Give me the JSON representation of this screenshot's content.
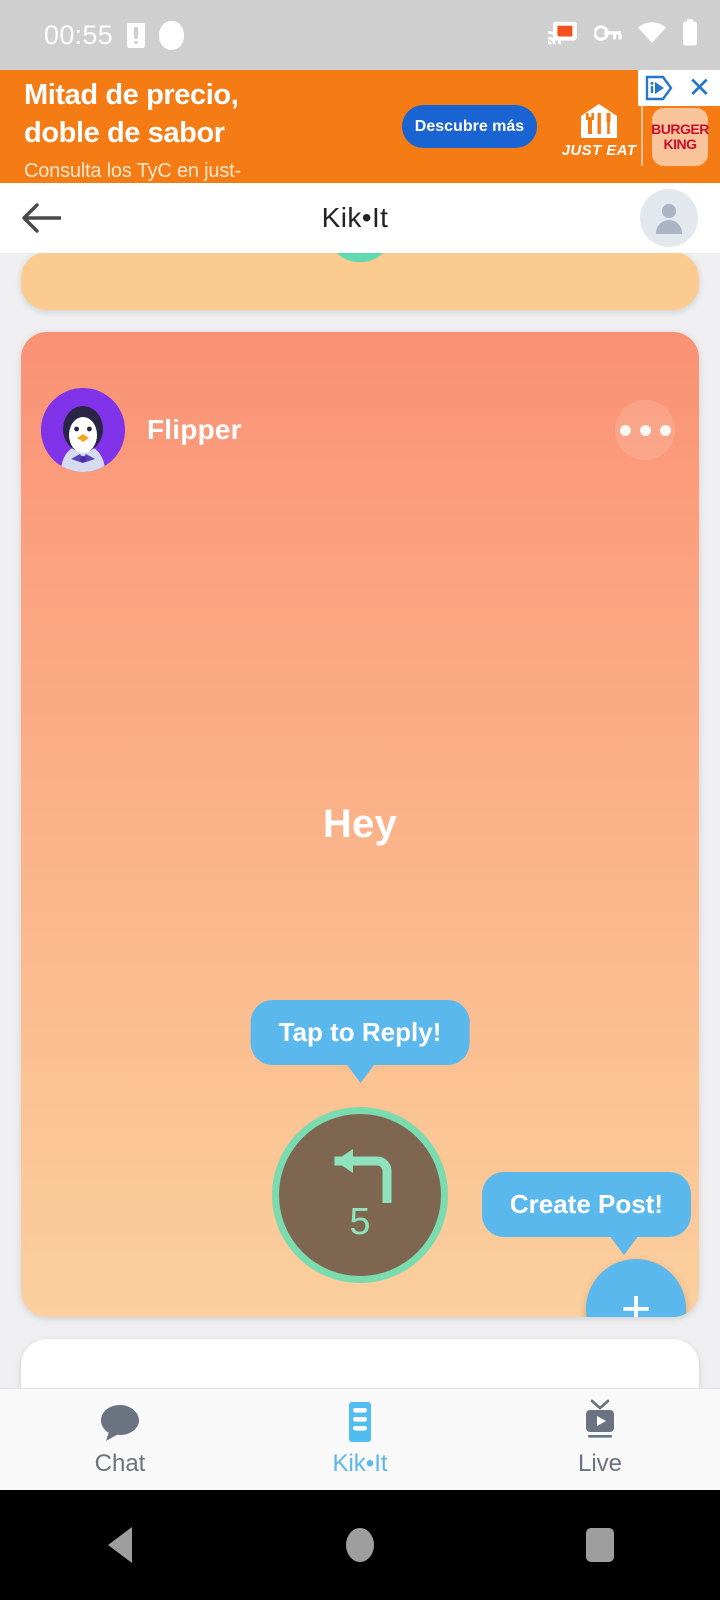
{
  "status_bar": {
    "time": "00:55",
    "icons": [
      "sim-card-icon",
      "recording-dot-icon",
      "cast-icon",
      "vpn-key-icon",
      "wifi-icon",
      "battery-icon"
    ]
  },
  "ad": {
    "headline_line1": "Mitad de precio,",
    "headline_line2": "doble de sabor",
    "subtext": "Consulta los TyC en just-eat.es/campana/descuentos",
    "cta_label": "Descubre más",
    "brand_name": "JUST EAT",
    "partner_line1": "BURGER",
    "partner_line2": "KING",
    "adchoices_icon": "adchoices-icon",
    "close_icon": "close-icon",
    "background_color": "#F57B14",
    "cta_color": "#1964D2"
  },
  "appbar": {
    "back_icon": "back-arrow-icon",
    "title": "Kik•It",
    "profile_icon": "account-avatar-icon"
  },
  "feed": {
    "previous_card": {
      "name": "previous-post-card"
    },
    "post": {
      "author": "Flipper",
      "avatar_icon": "penguin-avatar-icon",
      "more_icon": "more-options-icon",
      "message": "Hey",
      "reply_tooltip": "Tap to Reply!",
      "create_tooltip": "Create Post!",
      "reply_count": "5",
      "reply_icon": "reply-arrow-icon",
      "fab_icon": "plus-icon",
      "gradient_top": "#FA9175",
      "gradient_bottom": "#FBCF9F",
      "tooltip_color": "#5BB8EC",
      "reply_ring_color": "#79DBAE",
      "reply_fill_color": "#7F6651"
    }
  },
  "bottom_nav": {
    "active_color": "#5BB8EC",
    "inactive_color": "#6b7280",
    "items": [
      {
        "label": "Chat",
        "icon": "chat-bubble-icon",
        "active": false
      },
      {
        "label": "Kik•It",
        "icon": "feed-list-icon",
        "active": true
      },
      {
        "label": "Live",
        "icon": "live-tv-icon",
        "active": false
      }
    ]
  },
  "android_nav": {
    "back_icon": "android-back-icon",
    "home_icon": "android-home-icon",
    "recents_icon": "android-recents-icon"
  }
}
